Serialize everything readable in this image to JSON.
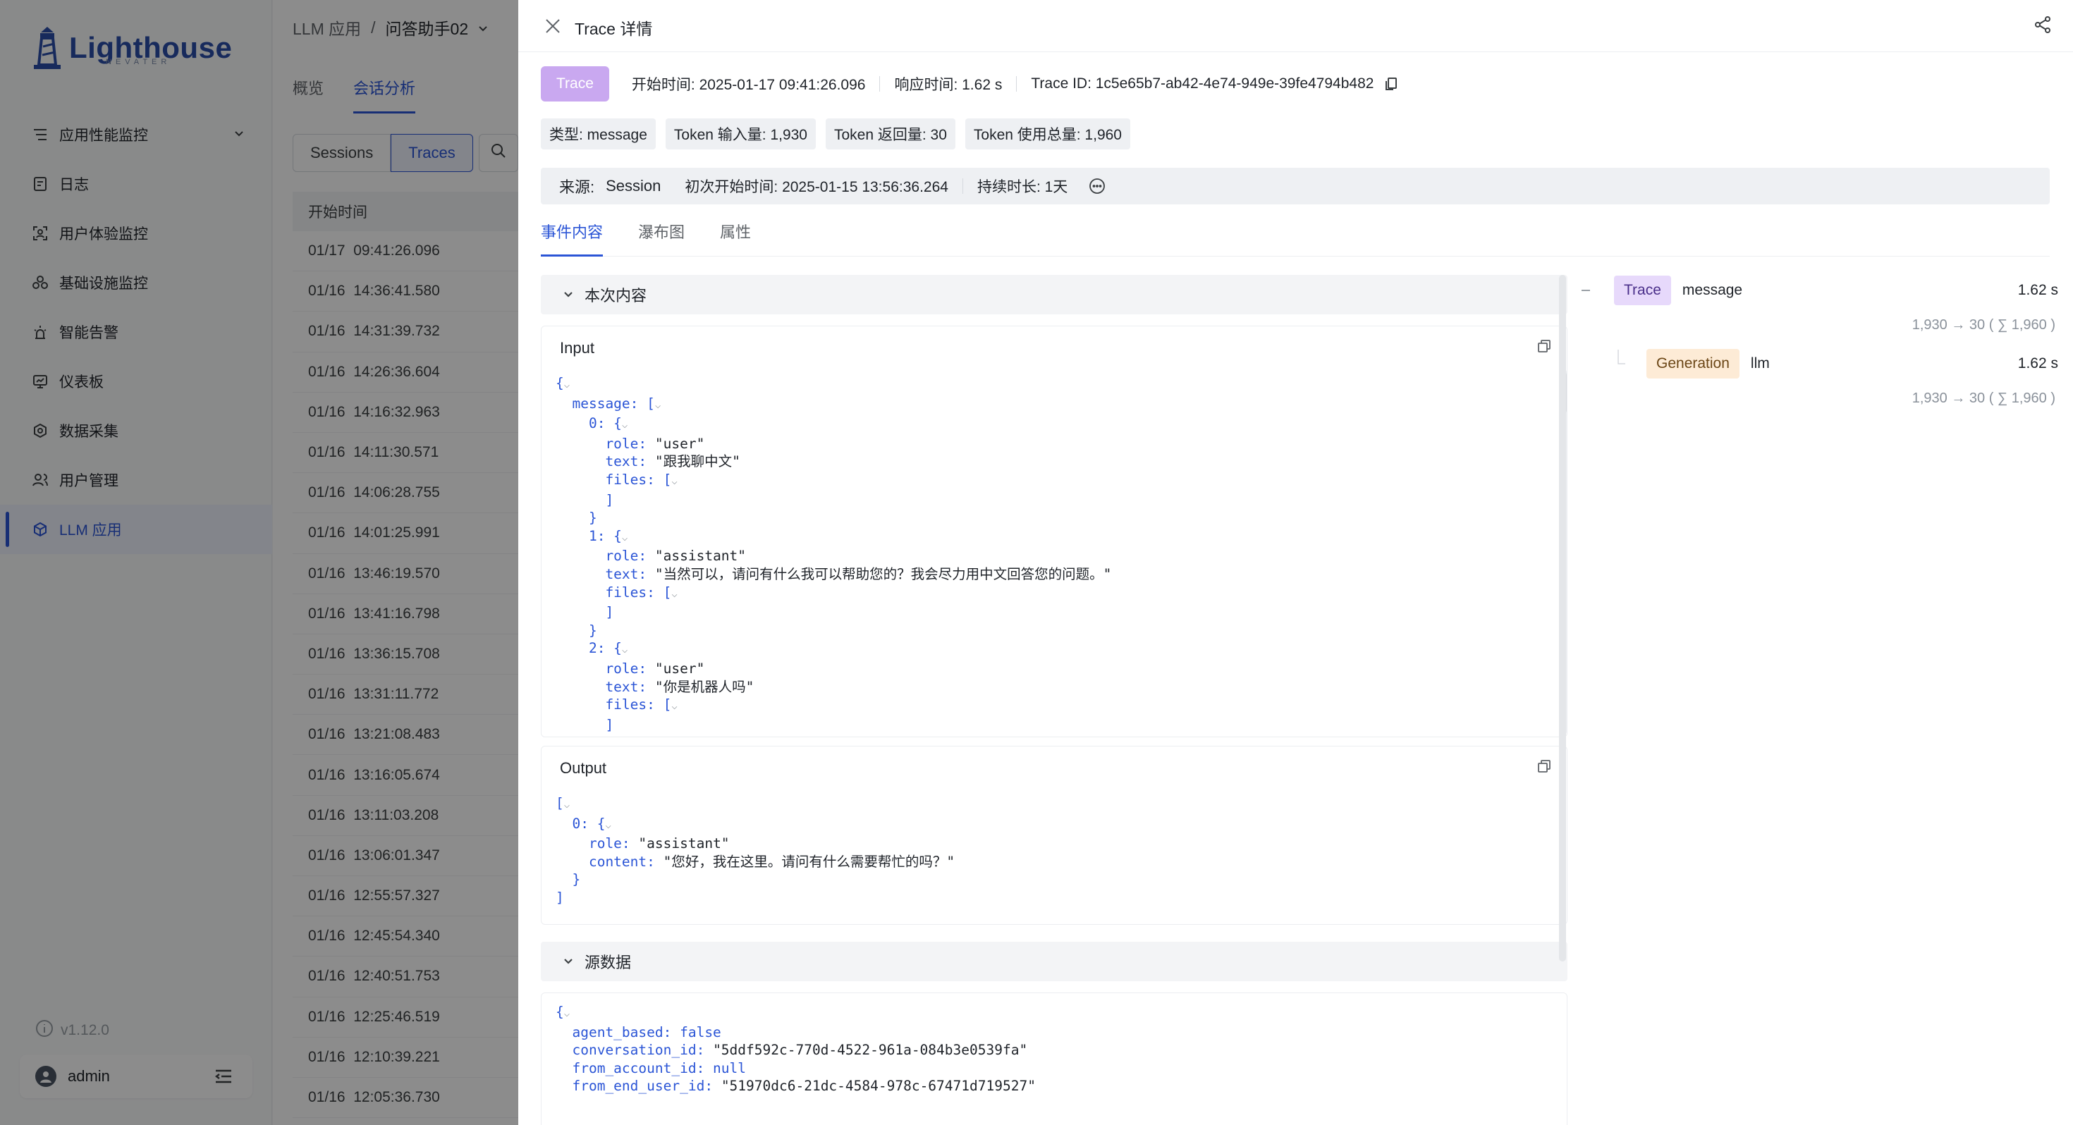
{
  "app": {
    "logo_text": "Lighthouse",
    "logo_sub": "NEVATER",
    "version": "v1.12.0",
    "user": "admin"
  },
  "sidebar": {
    "items": [
      {
        "label": "应用性能监控",
        "icon": "apm-icon",
        "expandable": true
      },
      {
        "label": "日志",
        "icon": "log-icon"
      },
      {
        "label": "用户体验监控",
        "icon": "user-experience-icon"
      },
      {
        "label": "基础设施监控",
        "icon": "infrastructure-icon"
      },
      {
        "label": "智能告警",
        "icon": "alert-icon"
      },
      {
        "label": "仪表板",
        "icon": "dashboard-icon"
      },
      {
        "label": "数据采集",
        "icon": "data-collection-icon"
      },
      {
        "label": "用户管理",
        "icon": "user-management-icon"
      },
      {
        "label": "LLM 应用",
        "icon": "llm-icon",
        "active": true
      }
    ]
  },
  "main": {
    "breadcrumb": {
      "parent": "LLM 应用",
      "separator": "/",
      "current": "问答助手02"
    },
    "tabs": [
      {
        "label": "概览"
      },
      {
        "label": "会话分析",
        "active": true
      }
    ],
    "segments": [
      {
        "label": "Sessions"
      },
      {
        "label": "Traces",
        "active": true
      }
    ],
    "table": {
      "header": "开始时间",
      "rows": [
        "01/17  09:41:26.096",
        "01/16  14:36:41.580",
        "01/16  14:31:39.732",
        "01/16  14:26:36.604",
        "01/16  14:16:32.963",
        "01/16  14:11:30.571",
        "01/16  14:06:28.755",
        "01/16  14:01:25.991",
        "01/16  13:46:19.570",
        "01/16  13:41:16.798",
        "01/16  13:36:15.708",
        "01/16  13:31:11.772",
        "01/16  13:21:08.483",
        "01/16  13:16:05.674",
        "01/16  13:11:03.208",
        "01/16  13:06:01.347",
        "01/16  12:55:57.327",
        "01/16  12:45:54.340",
        "01/16  12:40:51.753",
        "01/16  12:25:46.519",
        "01/16  12:10:39.221",
        "01/16  12:05:36.730"
      ]
    }
  },
  "drawer": {
    "title": "Trace 详情",
    "trace_tag": "Trace",
    "start_time": "开始时间: 2025-01-17 09:41:26.096",
    "response_time": "响应时间: 1.62 s",
    "trace_id": "Trace ID: 1c5e65b7-ab42-4e74-949e-39fe4794b482",
    "chips": [
      "类型: message",
      "Token 输入量: 1,930",
      "Token 返回量: 30",
      "Token 使用总量: 1,960"
    ],
    "source": {
      "label": "来源:",
      "value": "Session",
      "first_start": "初次开始时间: 2025-01-15 13:56:36.264",
      "duration": "持续时长: 1天"
    },
    "tabs": [
      {
        "label": "事件内容",
        "active": true
      },
      {
        "label": "瀑布图"
      },
      {
        "label": "属性"
      }
    ],
    "sections": {
      "current": "本次内容",
      "metadata": "源数据"
    },
    "input": {
      "title": "Input",
      "lines": [
        "{",
        "  message: [",
        "    0: {",
        "      role: \"user\"",
        "      text: \"跟我聊中文\"",
        "      files: [",
        "      ]",
        "    }",
        "    1: {",
        "      role: \"assistant\"",
        "      text: \"当然可以，请问有什么我可以帮助您的？我会尽力用中文回答您的问题。\"",
        "      files: [",
        "      ]",
        "    }",
        "    2: {",
        "      role: \"user\"",
        "      text: \"你是机器人吗\"",
        "      files: [",
        "      ]",
        "    }"
      ]
    },
    "output": {
      "title": "Output",
      "lines": [
        "[",
        "  0: {",
        "    role: \"assistant\"",
        "    content: \"您好，我在这里。请问有什么需要帮忙的吗？\"",
        "  }",
        "]"
      ]
    },
    "metadata_lines": [
      "{",
      "  agent_based: false",
      "  conversation_id: \"5ddf592c-770d-4522-961a-084b3e0539fa\"",
      "  from_account_id: null",
      "  from_end_user_id: \"51970dc6-21dc-4584-978c-67471d719527\""
    ],
    "tree": [
      {
        "badge": "Trace",
        "name": "message",
        "latency": "1.62 s",
        "tokens": "1,930 → 30 ( ∑ 1,960 )"
      },
      {
        "badge": "Generation",
        "name": "llm",
        "latency": "1.62 s",
        "tokens": "1,930 → 30 ( ∑ 1,960 )"
      }
    ]
  }
}
